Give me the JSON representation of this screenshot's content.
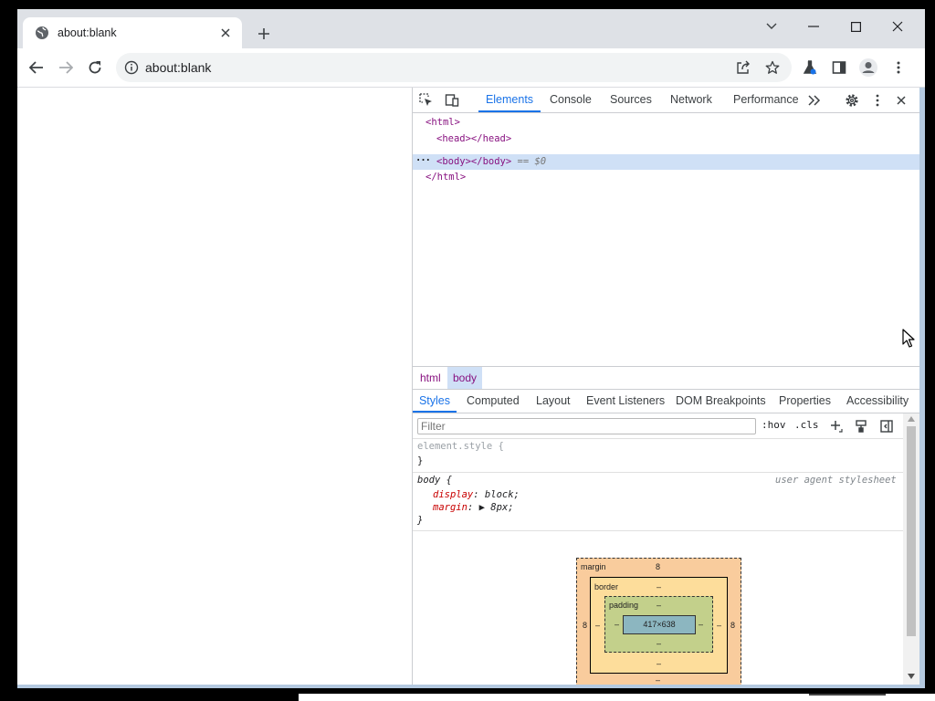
{
  "browser": {
    "tab": {
      "title": "about:blank",
      "icon": "globe-icon"
    },
    "address": "about:blank",
    "window_controls": [
      "tab-search-icon",
      "minimize-icon",
      "maximize-icon",
      "close-icon"
    ]
  },
  "devtools": {
    "tabs": [
      "Elements",
      "Console",
      "Sources",
      "Network",
      "Performance"
    ],
    "active_tab": "Elements",
    "dom": [
      "<html>",
      "<head></head>",
      "<body></body>",
      "== $0",
      "</html>"
    ],
    "breadcrumbs": [
      "html",
      "body"
    ],
    "subtabs": [
      "Styles",
      "Computed",
      "Layout",
      "Event Listeners",
      "DOM Breakpoints",
      "Properties",
      "Accessibility"
    ],
    "filter_placeholder": "Filter",
    "hov": ":hov",
    "cls": ".cls",
    "rules": {
      "element_style_selector": "element.style {",
      "close_brace": "}",
      "body_selector": "body {",
      "source": "user agent stylesheet",
      "props": [
        {
          "name": "display",
          "value": "block;"
        },
        {
          "name": "margin",
          "value": "8px;"
        }
      ]
    },
    "box_model": {
      "margin_label": "margin",
      "margin_top": "8",
      "margin_left": "8",
      "margin_right": "8",
      "margin_bottom": "–",
      "border_label": "border",
      "border_top": "–",
      "border_left": "–",
      "border_right": "–",
      "border_bottom": "–",
      "padding_label": "padding",
      "padding_top": "–",
      "padding_left": "–",
      "padding_right": "–",
      "padding_bottom": "–",
      "content": "417×638"
    }
  }
}
